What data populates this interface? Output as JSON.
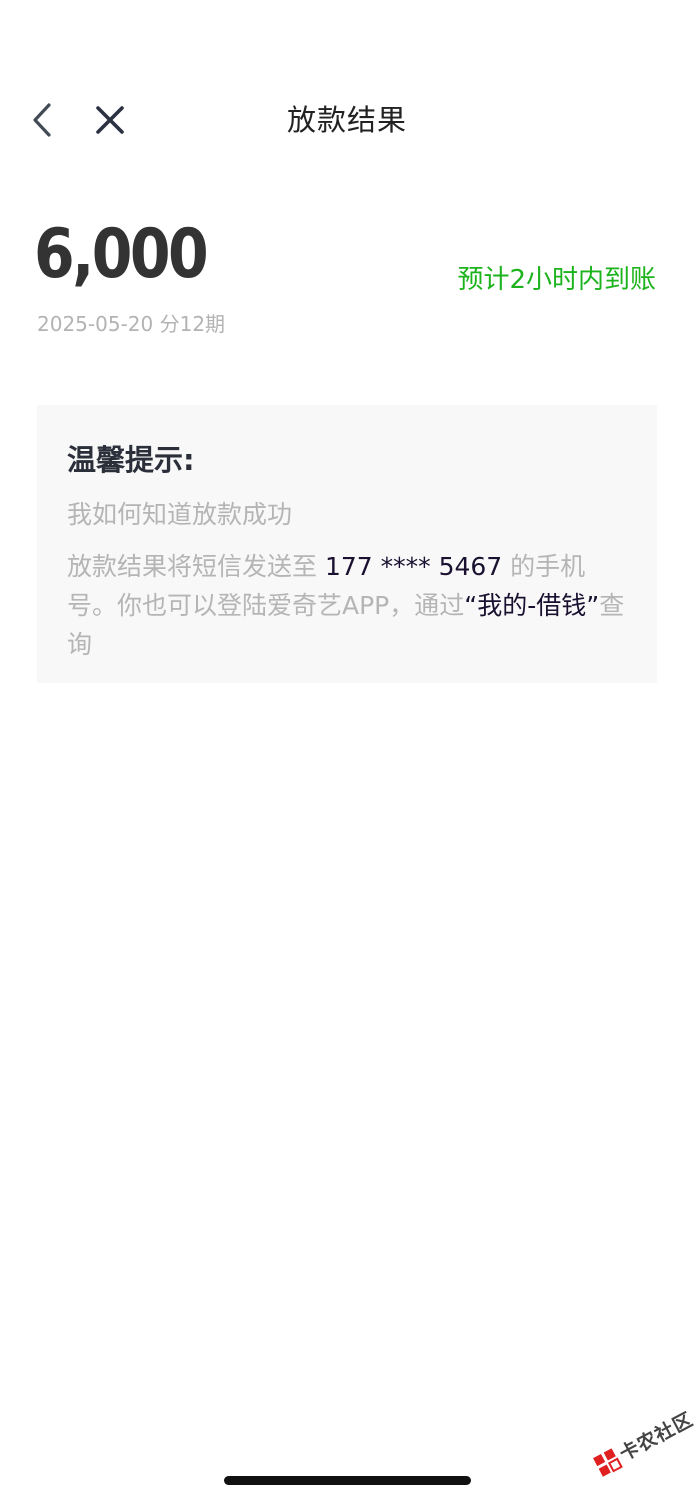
{
  "nav": {
    "title": "放款结果",
    "back_icon": "chevron-left-icon",
    "close_icon": "close-icon"
  },
  "loan": {
    "amount": "6,000",
    "arrival_estimate": "预计2小时内到账",
    "date": "2025-05-20",
    "installments": "分12期"
  },
  "tip": {
    "title": "温馨提示:",
    "question": "我如何知道放款成功",
    "body_part1": "放款结果将短信发送至",
    "phone": "177 **** 5467",
    "body_part2": "的手机号。你也可以登陆爱奇艺APP，通过",
    "path_label": "“我的-借钱”",
    "body_part3": "查询"
  },
  "watermark": {
    "text": "卡农社区"
  },
  "colors": {
    "accent_green": "#1db31d",
    "text_dark": "#333333",
    "text_muted": "#b5b5b5",
    "card_bg": "#f8f8f8"
  }
}
